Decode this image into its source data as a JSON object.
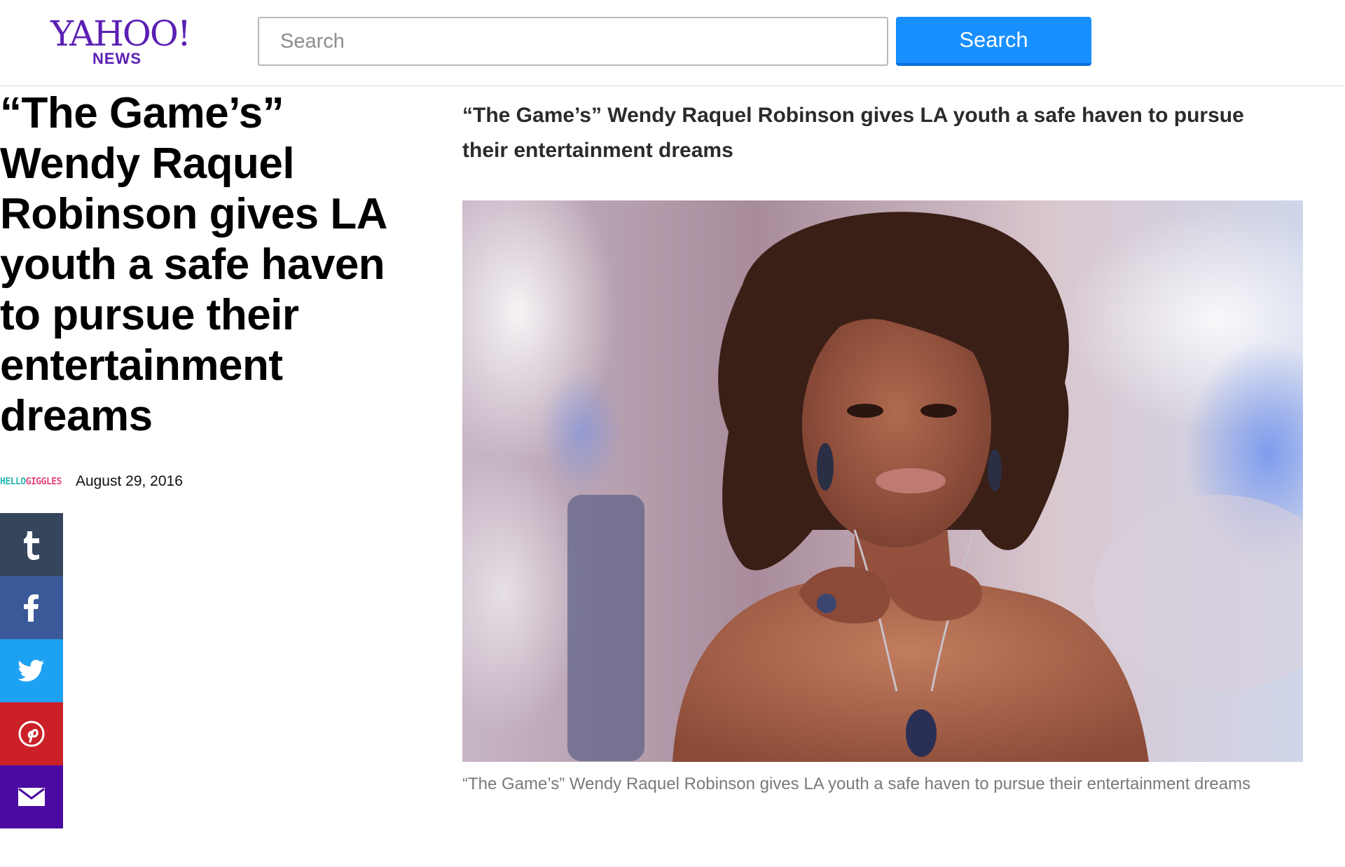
{
  "header": {
    "logo_main": "YAHOO!",
    "logo_sub": "NEWS",
    "search_placeholder": "Search",
    "search_button_label": "Search",
    "brand_color": "#5a1fb3",
    "search_button_color": "#188fff"
  },
  "article": {
    "headline": "“The Game’s” Wendy Raquel Robinson gives LA youth a safe haven to pursue their entertainment dreams",
    "provider_logo_part1": "HELLO",
    "provider_logo_part2": "GIGGLES",
    "date": "August 29, 2016",
    "subtitle": "“The Game’s” Wendy Raquel Robinson gives LA youth a safe haven to pursue their entertainment dreams",
    "photo_icon": "portrait-photo",
    "caption": "“The Game’s” Wendy Raquel Robinson gives LA youth a safe haven to pursue their entertainment dreams"
  },
  "share": {
    "items": [
      {
        "icon": "tumblr-icon",
        "color": "#35465c"
      },
      {
        "icon": "facebook-icon",
        "color": "#3b5998"
      },
      {
        "icon": "twitter-icon",
        "color": "#1da1f2"
      },
      {
        "icon": "pinterest-icon",
        "color": "#cb2027"
      },
      {
        "icon": "mail-icon",
        "color": "#4b0aa1"
      }
    ]
  }
}
